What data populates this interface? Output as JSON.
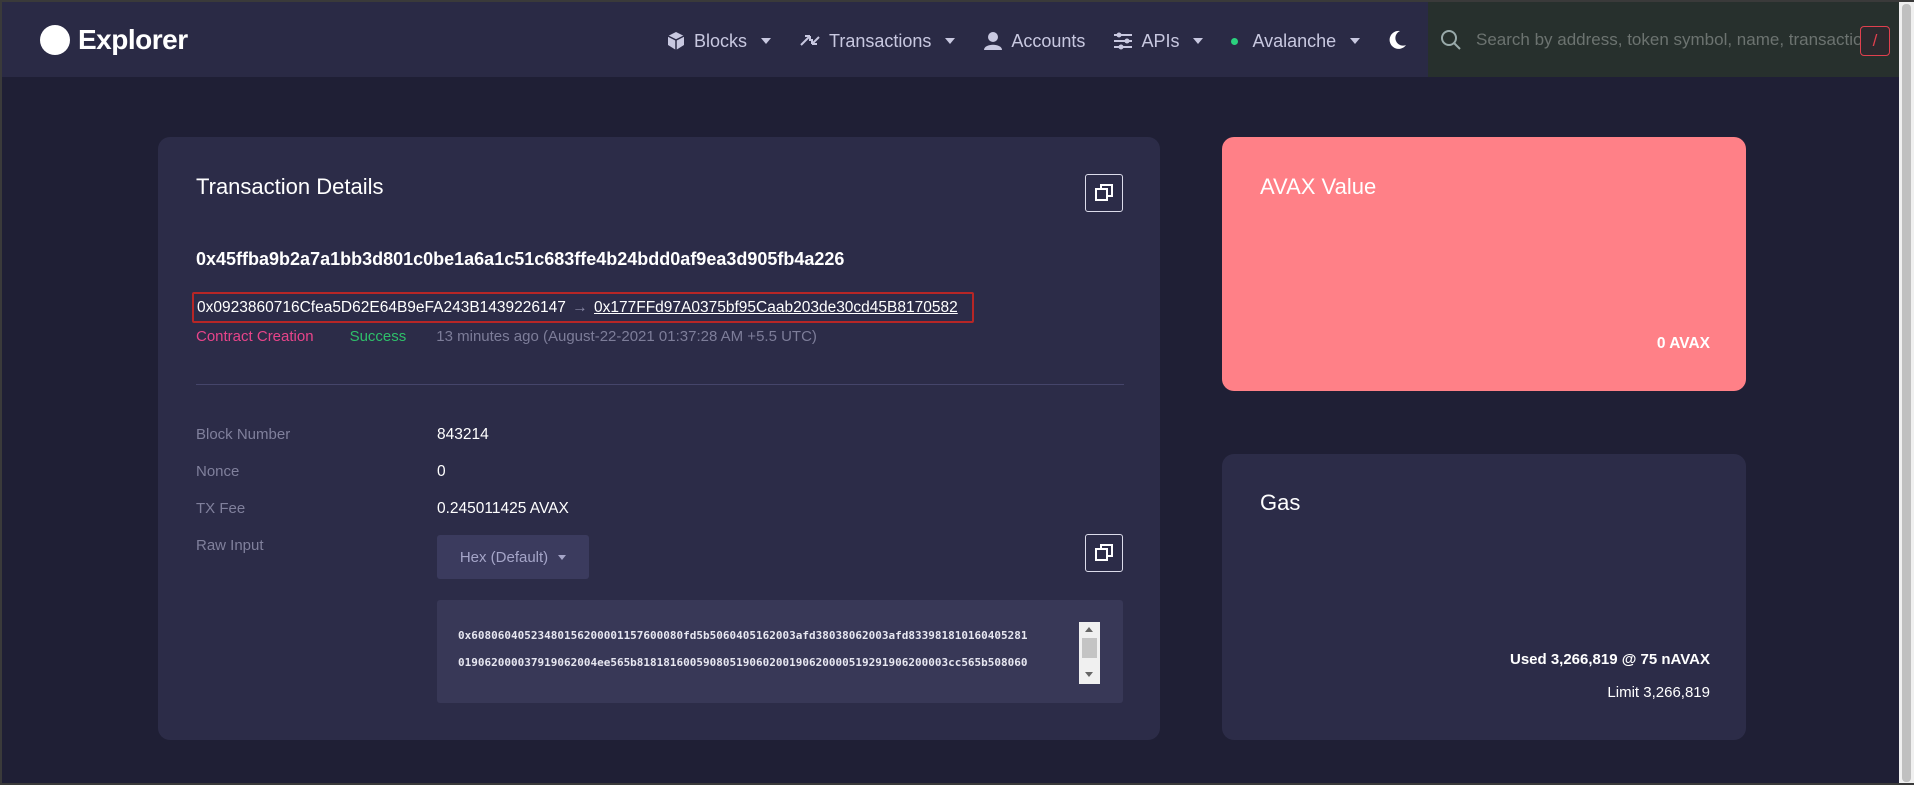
{
  "app": {
    "name": "Explorer"
  },
  "nav": {
    "blocks": "Blocks",
    "transactions": "Transactions",
    "accounts": "Accounts",
    "apis": "APIs",
    "network": "Avalanche"
  },
  "search": {
    "placeholder": "Search by address, token symbol, name, transaction hash",
    "shortcut": "/"
  },
  "transaction": {
    "title": "Transaction Details",
    "hash": "0x45ffba9b2a7a1bb3d801c0be1a6a1c51c683ffe4b24bdd0af9ea3d905fb4a226",
    "from": "0x0923860716Cfea5D62E64B9eFA243B1439226147",
    "arrow": "→",
    "to": "0x177FFd97A0375bf95Caab203de30cd45B8170582",
    "type": "Contract Creation",
    "status": "Success",
    "time": "13 minutes ago (August-22-2021 01:37:28 AM +5.5 UTC)",
    "fields": {
      "block_number_label": "Block Number",
      "block_number": "843214",
      "nonce_label": "Nonce",
      "nonce": "0",
      "tx_fee_label": "TX Fee",
      "tx_fee": "0.245011425 AVAX",
      "raw_input_label": "Raw Input"
    },
    "raw_format": "Hex (Default)",
    "raw_lines": [
      "0x60806040523480156200001157600080fd5b5060405162003afd38038062003afd833981810160405281",
      "019062000037919062004ee565b81818160059080519060200190620000519291906200003cc565b508060"
    ]
  },
  "avax_card": {
    "title": "AVAX Value",
    "value": "0 AVAX"
  },
  "gas_card": {
    "title": "Gas",
    "used": "Used 3,266,819 @ 75 nAVAX",
    "limit": "Limit 3,266,819"
  },
  "colors": {
    "background": "#1f1f35",
    "card": "#2c2c48",
    "avax_card": "#ff8087",
    "contract_creation": "#e8448a",
    "success": "#2ebf6a"
  }
}
